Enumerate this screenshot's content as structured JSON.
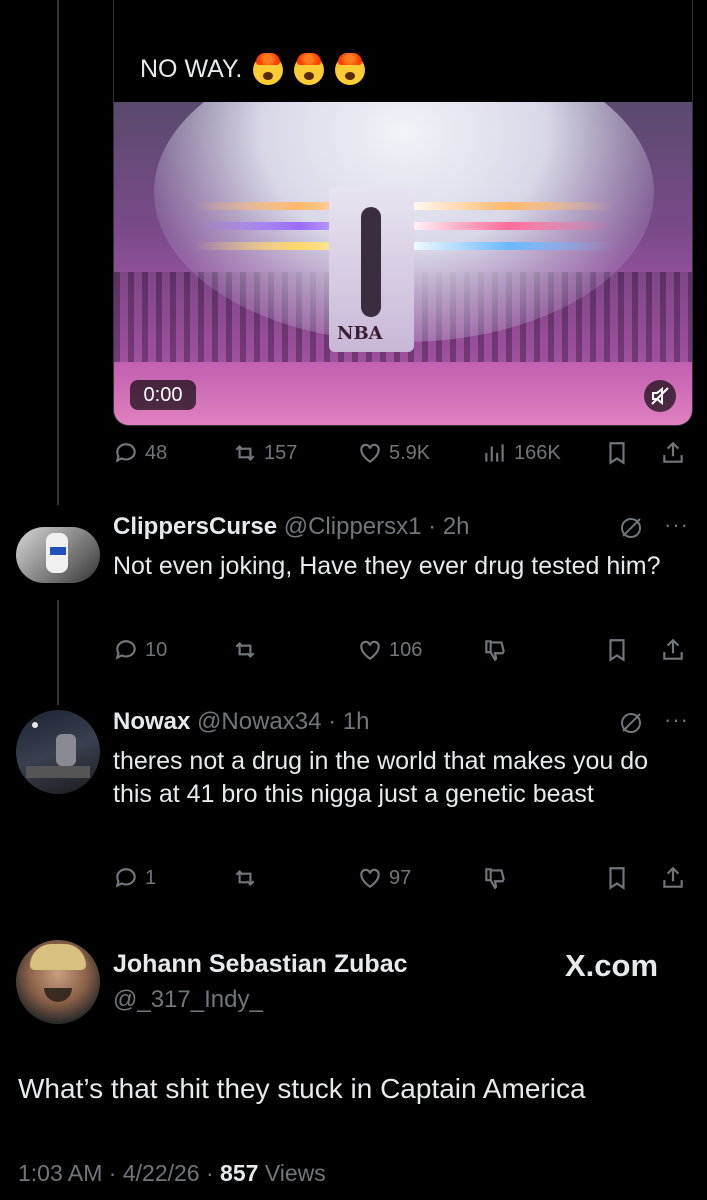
{
  "quote": {
    "text": "NO WAY.",
    "emojis": [
      "exploding-head-emoji",
      "exploding-head-emoji",
      "exploding-head-emoji"
    ],
    "video_time": "0:00",
    "video_logo_text": "NBA"
  },
  "main_actions": {
    "replies": "48",
    "reposts": "157",
    "likes": "5.9K",
    "views": "166K"
  },
  "replies": [
    {
      "name": "ClippersCurse",
      "handle": "@Clippersx1",
      "sep": "·",
      "time": "2h",
      "text": "Not even joking, Have they ever drug tested him?",
      "replies": "10",
      "likes": "106"
    },
    {
      "name": "Nowax",
      "handle": "@Nowax34",
      "sep": "·",
      "time": "1h",
      "text": "theres not a drug in the world that makes you do this at 41 bro this nigga just a genetic beast",
      "replies": "1",
      "likes": "97"
    }
  ],
  "footer_post": {
    "name": "Johann Sebastian Zubac",
    "handle": "@_317_Indy_",
    "brand": "X.com",
    "text": "What’s that shit they stuck in Captain America",
    "time": "1:03 AM",
    "sep1": "·",
    "date": "4/22/26",
    "sep2": "·",
    "views_count": "857",
    "views_label": "Views"
  },
  "colors": {
    "background": "#000000",
    "text": "#e7e9ea",
    "muted": "#71767b",
    "border": "#2f3336"
  }
}
